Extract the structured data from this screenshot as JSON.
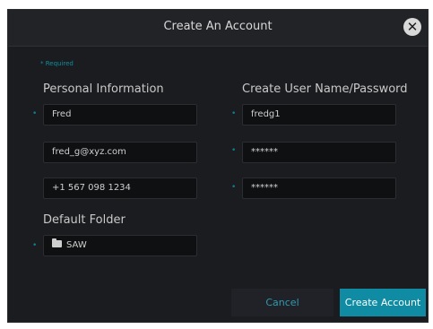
{
  "dialog": {
    "title": "Create An Account",
    "close_icon_glyph": "✕"
  },
  "form": {
    "required_label": "* Required",
    "personal_heading": "Personal Information",
    "credentials_heading": "Create User Name/Password",
    "default_folder_heading": "Default Folder",
    "required_marker": "•",
    "fields": {
      "first_name": "Fred",
      "email": "fred_g@xyz.com",
      "phone": "+1 567 098 1234",
      "username": "fredg1",
      "password": "******",
      "confirm_password": "******",
      "default_folder": "SAW"
    }
  },
  "buttons": {
    "cancel": "Cancel",
    "create_account": "Create Account"
  },
  "icons": {
    "close": "close-icon",
    "folder": "folder-icon"
  },
  "colors": {
    "accent": "#0f8ba3",
    "background": "#1b1c1f",
    "field_background": "#0f1012"
  }
}
